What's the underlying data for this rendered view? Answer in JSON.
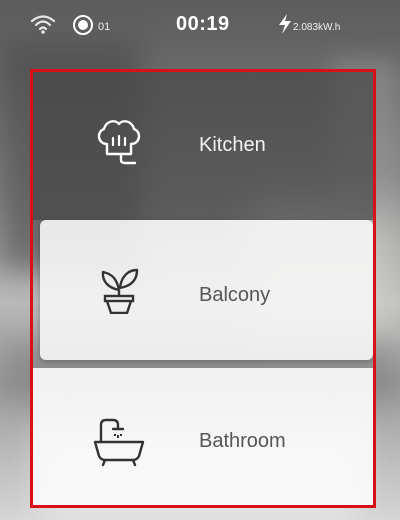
{
  "status_bar": {
    "wifi_icon": "wifi-icon",
    "record_icon": "record-icon",
    "count": "01",
    "time": "00:19",
    "energy_icon": "lightning-bolt-icon",
    "energy": "2.083kW.h"
  },
  "rooms": [
    {
      "label": "Kitchen",
      "icon": "chef-hat-icon",
      "selected": true
    },
    {
      "label": "Balcony",
      "icon": "potted-plant-icon",
      "selected": false
    },
    {
      "label": "Bathroom",
      "icon": "bathtub-icon",
      "selected": false
    }
  ],
  "colors": {
    "highlight_border": "#d8101a",
    "selected_card": "#484848",
    "card": "#f4f4f4"
  }
}
